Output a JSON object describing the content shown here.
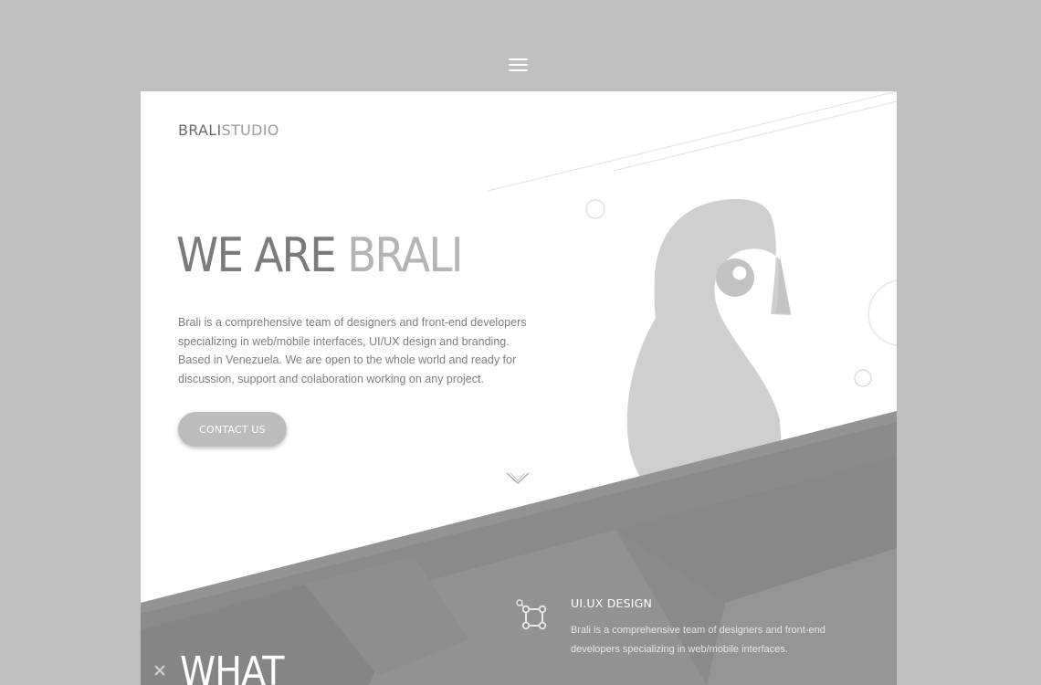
{
  "header": {
    "menu_icon": "hamburger-icon"
  },
  "brand": {
    "part1": "BRALI",
    "part2": "STUDIO"
  },
  "hero": {
    "title_part1": "WE ARE ",
    "title_part2": "BRALI",
    "description": "Brali is a comprehensive team of designers and front-end developers specializing in web/mobile interfaces, UI/UX design and branding. Based in Venezuela. We are open to the whole world and ready for discussion, support and colaboration working on any project.",
    "cta_label": "CONTACT US",
    "scroll_icon": "chevron-down-icon",
    "mascot": "penguin-illustration"
  },
  "services": {
    "items": [
      {
        "icon": "vector-nodes-icon",
        "title": "UI.UX DESIGN",
        "text": "Brali is a comprehensive team of designers and front-end developers specializing in web/mobile interfaces."
      }
    ],
    "section_title": "WHAT",
    "close_icon": "close-icon"
  },
  "colors": {
    "page_bg": "#bfbfbf",
    "card_bg": "#ffffff",
    "accent_gray": "#b4b4b4",
    "dark_section": "#8c8c8c"
  }
}
